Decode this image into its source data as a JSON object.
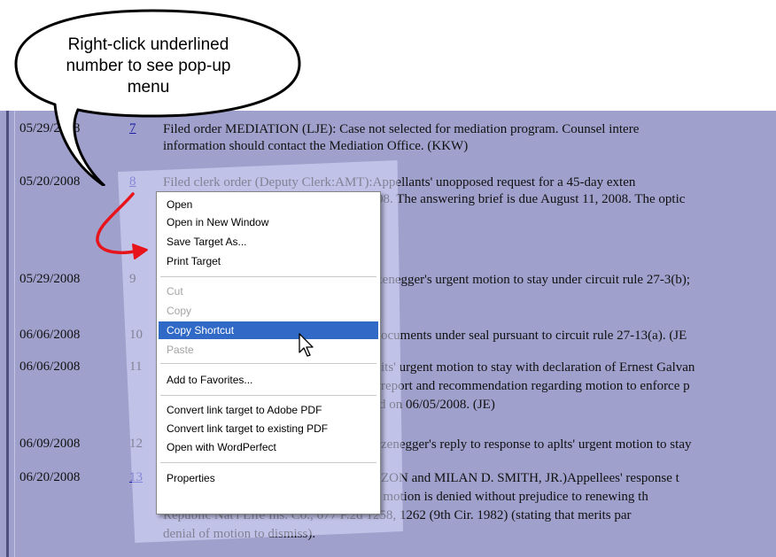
{
  "callout": {
    "text": "Right-click underlined number to see pop-up menu"
  },
  "docket": {
    "entries": [
      {
        "date": "05/29/2008",
        "num": "7",
        "link": true,
        "lines": [
          "Filed order MEDIATION (LJE): Case not selected for mediation program. Counsel intere",
          "information should contact the Mediation Office. (KKW)"
        ]
      },
      {
        "date": "05/20/2008",
        "num": "8",
        "link": true,
        "lines": [
          "Filed clerk order (Deputy Clerk:AMT):Appellants' unopposed request for a 45-day exten",
          "08. The answering brief is due August 11, 2008. The optic"
        ]
      },
      {
        "date": "05/29/2008",
        "num": "9",
        "link": false,
        "lines": [
          "zenegger's urgent motion to stay under circuit rule 27-3(b);"
        ]
      },
      {
        "date": "06/06/2008",
        "num": "10",
        "link": false,
        "lines": [
          "ocuments under seal pursuant to circuit rule 27-13(a). (JE"
        ]
      },
      {
        "date": "06/06/2008",
        "num": "11",
        "link": false,
        "lines": [
          "its' urgent motion to stay with declaration of Ernest Galvan",
          "report and recommendation regarding motion to enforce p",
          "d on 06/05/2008. (JE)"
        ]
      },
      {
        "date": "06/09/2008",
        "num": "12",
        "link": false,
        "lines": [
          "zenegger's reply to response to aplts' urgent motion to stay"
        ]
      },
      {
        "date": "06/20/2008",
        "num": "13",
        "link": true,
        "lines": [
          "ZON and MILAN D. SMITH, JR.)Appellees' response t",
          "motion to dismiss, and, so construed, the motion is denied without prejudice to renewing th",
          "Republic Nat'l Life Ins. Co., 677 F.2d 1258, 1262 (9th Cir. 1982) (stating that merits par",
          "denial of motion to dismiss)."
        ]
      }
    ]
  },
  "context_menu": {
    "items": [
      {
        "label": "Open",
        "state": "normal"
      },
      {
        "label": "Open in New Window",
        "state": "normal"
      },
      {
        "label": "Save Target As...",
        "state": "normal"
      },
      {
        "label": "Print Target",
        "state": "normal"
      },
      {
        "label": "Cut",
        "state": "disabled"
      },
      {
        "label": "Copy",
        "state": "disabled"
      },
      {
        "label": "Copy Shortcut",
        "state": "selected"
      },
      {
        "label": "Paste",
        "state": "disabled"
      },
      {
        "label": "Add to Favorites...",
        "state": "normal"
      },
      {
        "label": "Convert link target to Adobe PDF",
        "state": "normal"
      },
      {
        "label": "Convert link target to existing PDF",
        "state": "normal"
      },
      {
        "label": "Open with WordPerfect",
        "state": "normal"
      },
      {
        "label": "Properties",
        "state": "normal"
      }
    ]
  },
  "colors": {
    "panel_bg": "#9fa0cc",
    "highlight": "#3169c6",
    "link": "#1a1aa6",
    "arrow": "#e8141c"
  },
  "icons": [
    "mouse-pointer-icon",
    "red-curved-arrow"
  ]
}
